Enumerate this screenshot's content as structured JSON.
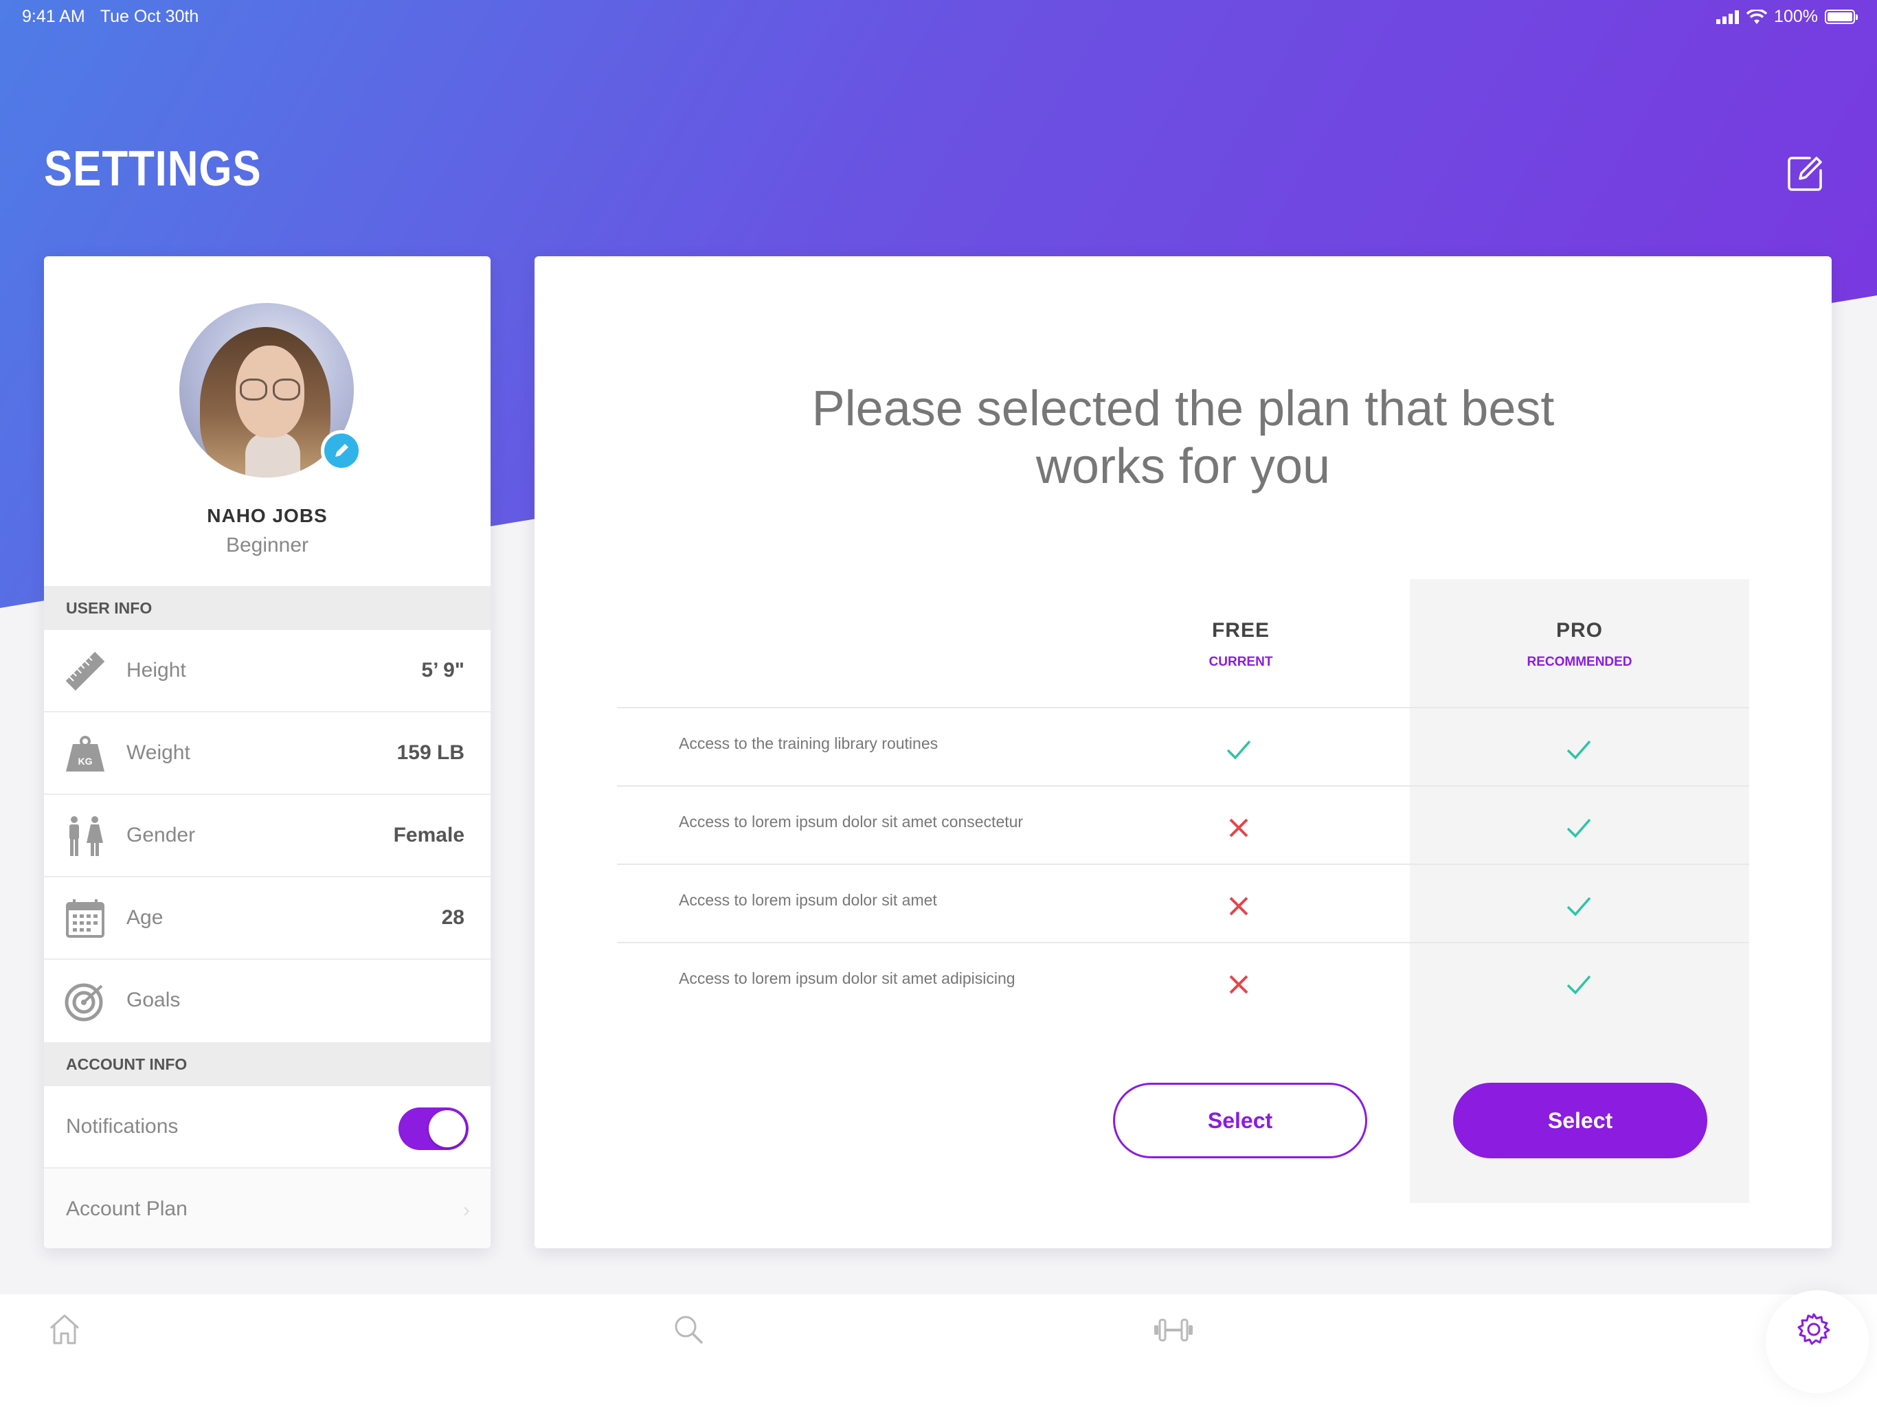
{
  "status_bar": {
    "time": "9:41 AM",
    "date": "Tue Oct 30th",
    "battery": "100%"
  },
  "header": {
    "title": "SETTINGS",
    "edit_icon": "edit-icon"
  },
  "profile": {
    "name": "NAHO JOBS",
    "level": "Beginner",
    "user_info_label": "USER INFO",
    "rows": [
      {
        "label": "Height",
        "value": "5’ 9\"",
        "icon": "ruler-icon"
      },
      {
        "label": "Weight",
        "value": "159 LB",
        "icon": "weight-icon"
      },
      {
        "label": "Gender",
        "value": "Female",
        "icon": "gender-icon"
      },
      {
        "label": "Age",
        "value": "28",
        "icon": "calendar-icon"
      },
      {
        "label": "Goals",
        "value": "",
        "icon": "target-icon"
      }
    ],
    "account_info_label": "ACCOUNT INFO",
    "notifications_label": "Notifications",
    "notifications_on": true,
    "account_plan_label": "Account Plan"
  },
  "plans": {
    "title_line1": "Please selected the plan that best",
    "title_line2": "works for you",
    "free": {
      "name": "FREE",
      "tag": "CURRENT",
      "select_label": "Select"
    },
    "pro": {
      "name": "PRO",
      "tag": "RECOMMENDED",
      "select_label": "Select"
    },
    "features": [
      {
        "text": "Access to the training library routines",
        "free": true,
        "pro": true
      },
      {
        "text": "Access to lorem ipsum dolor sit amet consectetur",
        "free": false,
        "pro": true
      },
      {
        "text": "Access to lorem ipsum dolor sit amet",
        "free": false,
        "pro": true
      },
      {
        "text": "Access to lorem ipsum dolor sit amet adipisicing",
        "free": false,
        "pro": true
      }
    ]
  },
  "tab_bar": {
    "items": [
      "home-icon",
      "search-icon",
      "dumbbell-icon",
      "gear-icon"
    ],
    "active": "gear-icon"
  },
  "colors": {
    "accent": "#8b1ce0",
    "check": "#2ec4a5",
    "cross": "#e8434b"
  }
}
